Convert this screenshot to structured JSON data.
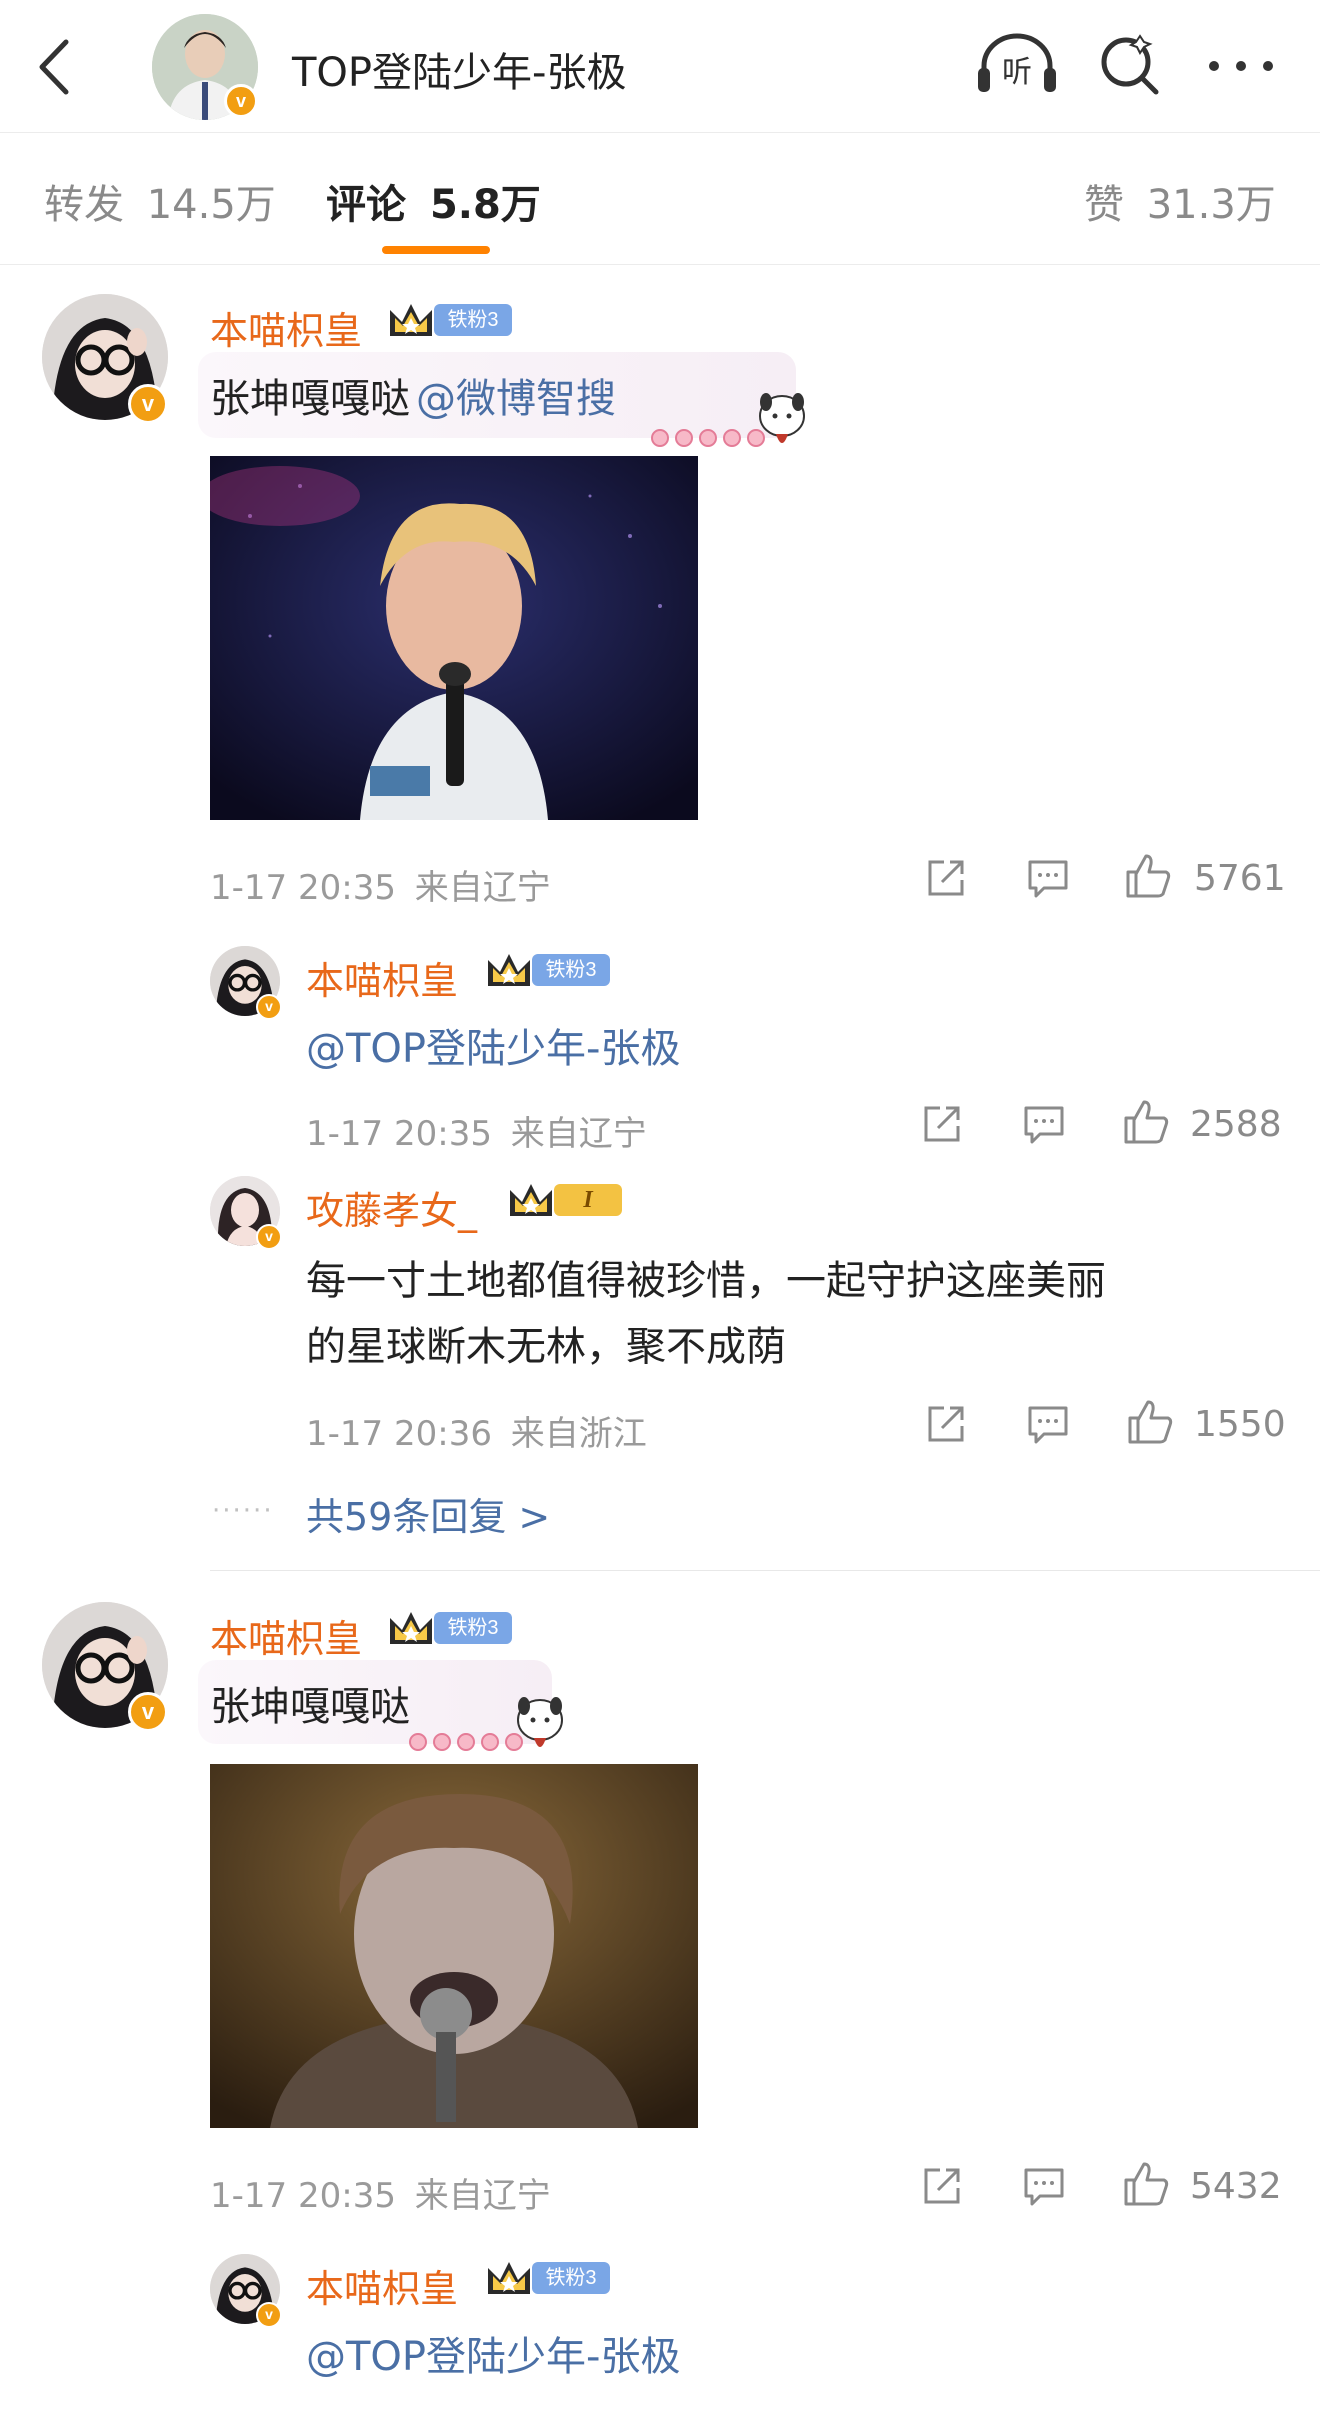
{
  "header": {
    "title": "TOP登陆少年-张极",
    "icons": [
      "back-arrow-icon",
      "headphone-listen-icon",
      "search-icon",
      "more-icon"
    ],
    "listen_glyph": "听"
  },
  "tabs": {
    "repost_label": "转发",
    "repost_count": "14.5万",
    "comment_label": "评论",
    "comment_count": "5.8万",
    "like_label": "赞",
    "like_count": "31.3万"
  },
  "colors": {
    "accent": "#ff8200",
    "username": "#e8681a",
    "mention": "#4a6fa5",
    "fan_badge": "#7aa6e6"
  },
  "comments": [
    {
      "user": "本喵枳皇",
      "badge": "铁粉3",
      "text": "张坤嘎嘎哒",
      "mention": "@微博智搜",
      "time": "1-17 20:35",
      "location": "来自辽宁",
      "likes": "5761",
      "replies": [
        {
          "user": "本喵枳皇",
          "badge": "铁粉3",
          "text": "@TOP登陆少年-张极",
          "time": "1-17 20:35",
          "location": "来自辽宁",
          "likes": "2588"
        },
        {
          "user": "攻藤孝女_",
          "badge": "I",
          "line1": "每一寸土地都值得被珍惜，一起守护这座美丽",
          "line2": "的星球断木无林，聚不成荫",
          "time": "1-17 20:36",
          "location": "来自浙江",
          "likes": "1550"
        }
      ],
      "more_replies": "共59条回复 >"
    },
    {
      "user": "本喵枳皇",
      "badge": "铁粉3",
      "text": "张坤嘎嘎哒",
      "time": "1-17 20:35",
      "location": "来自辽宁",
      "likes": "5432",
      "replies": [
        {
          "user": "本喵枳皇",
          "badge": "铁粉3",
          "text": "@TOP登陆少年-张极"
        }
      ]
    }
  ],
  "vip_glyph": "v"
}
